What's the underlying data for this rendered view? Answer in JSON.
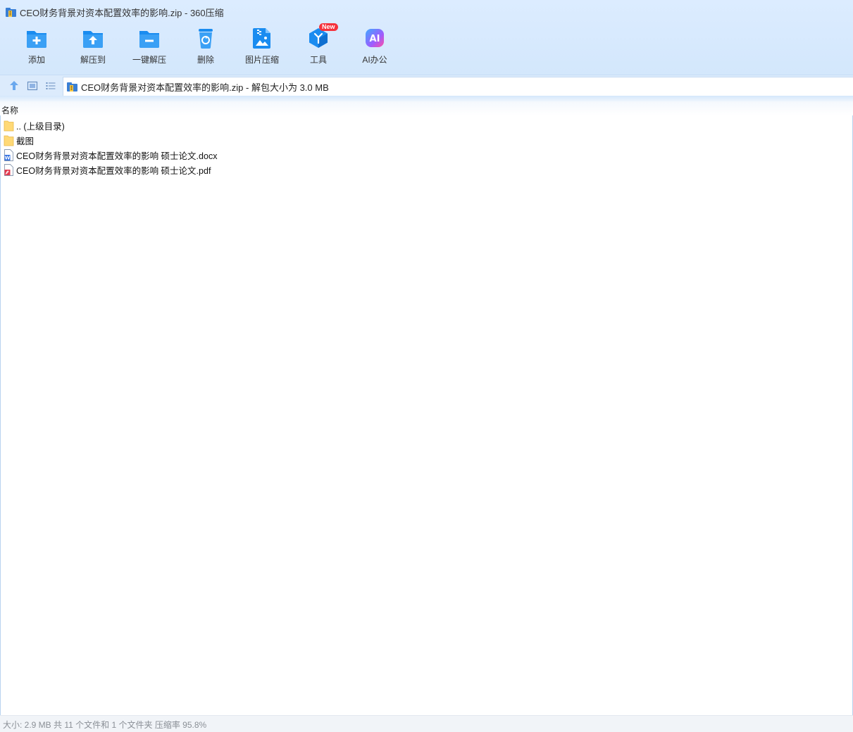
{
  "window": {
    "title": "CEO财务背景对资本配置效率的影响.zip - 360压缩"
  },
  "toolbar": {
    "items": [
      {
        "label": "添加",
        "icon": "add-icon"
      },
      {
        "label": "解压到",
        "icon": "extract-to-icon"
      },
      {
        "label": "一键解压",
        "icon": "one-click-extract-icon"
      },
      {
        "label": "删除",
        "icon": "delete-icon"
      },
      {
        "label": "图片压缩",
        "icon": "image-compress-icon"
      },
      {
        "label": "工具",
        "icon": "tools-icon",
        "badge": "New"
      },
      {
        "label": "AI办公",
        "icon": "ai-office-icon",
        "icon_text": "AI"
      }
    ]
  },
  "navbar": {
    "path": "CEO财务背景对资本配置效率的影响.zip - 解包大小为 3.0 MB"
  },
  "list": {
    "column_name": "名称",
    "rows": [
      {
        "name": ".. (上级目录)",
        "type": "folder"
      },
      {
        "name": "截图",
        "type": "folder"
      },
      {
        "name": "CEO财务背景对资本配置效率的影响 硕士论文.docx",
        "type": "docx"
      },
      {
        "name": "CEO财务背景对资本配置效率的影响 硕士论文.pdf",
        "type": "pdf"
      }
    ]
  },
  "status": {
    "text": "大小: 2.9 MB 共 11 个文件和 1 个文件夹 压缩率 95.8%"
  },
  "colors": {
    "toolbar_bg": "#d3e7fc",
    "icon_blue": "#1a8cf0",
    "badge_red": "#f5323c",
    "folder_yellow": "#ffd976"
  }
}
